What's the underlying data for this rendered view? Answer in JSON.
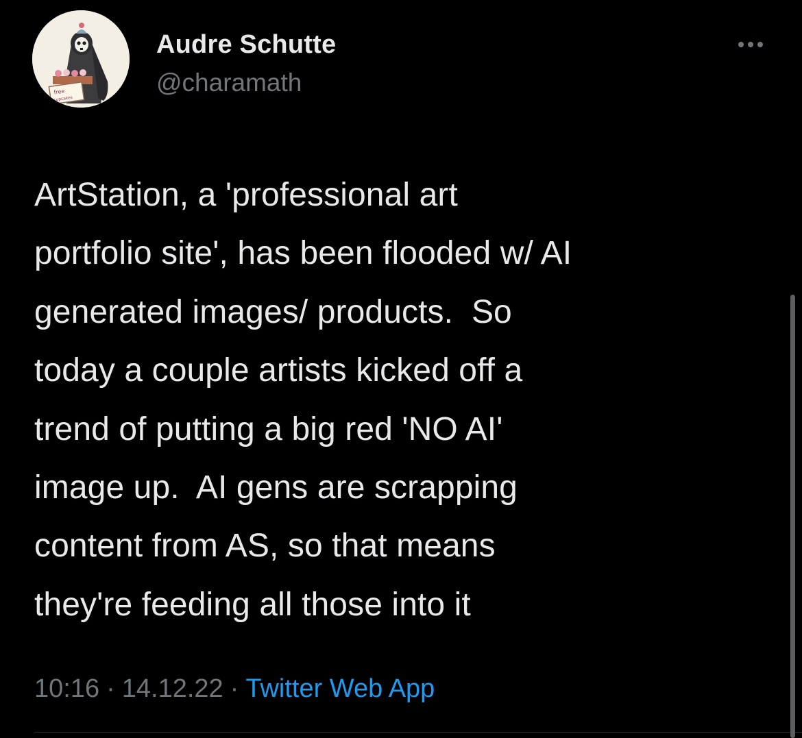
{
  "author": {
    "display_name": "Audre Schutte",
    "handle": "@charamath",
    "avatar_sign_text": "free cupcakes"
  },
  "tweet": {
    "lines": [
      "ArtStation, a 'professional art",
      "portfolio site', has been flooded w/ AI",
      "generated images/ products.  So",
      "today a couple artists kicked off a",
      "trend of putting a big red 'NO AI'",
      "image up.  AI gens are scrapping",
      "content from AS, so that means",
      "they're feeding all those into it"
    ]
  },
  "meta": {
    "time": "10:16",
    "date": "14.12.22",
    "separator": "·",
    "source": "Twitter Web App"
  },
  "icons": {
    "more": "more-horizontal-icon"
  },
  "colors": {
    "background": "#000000",
    "text_primary": "#e7e9ea",
    "text_secondary": "#71767b",
    "link": "#1d9bf0"
  }
}
